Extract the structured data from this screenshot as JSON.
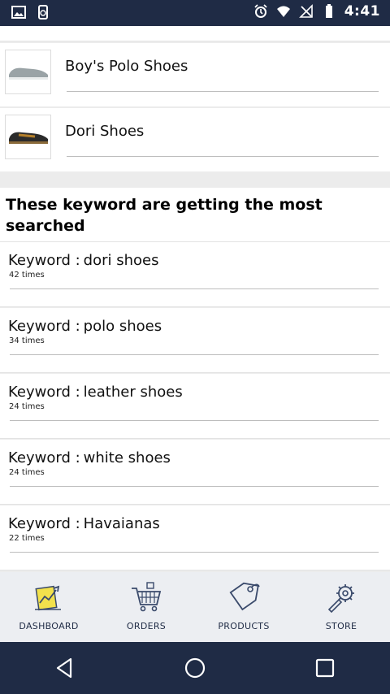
{
  "status_bar": {
    "time": "4:41",
    "icons": [
      "gallery-icon",
      "screenshot-icon",
      "alarm-icon",
      "wifi-icon",
      "no-signal-icon",
      "battery-icon"
    ]
  },
  "products": [
    {
      "name": "Boy's Polo Shoes",
      "image": "grey-shoe-image"
    },
    {
      "name": "Dori Shoes",
      "image": "black-shoe-image"
    }
  ],
  "keywords_section": {
    "title": "These keyword are getting the most searched",
    "items": [
      {
        "label": "Keyword :",
        "value": "dori shoes",
        "count": "42 times"
      },
      {
        "label": "Keyword :",
        "value": "polo shoes",
        "count": "34 times"
      },
      {
        "label": "Keyword :",
        "value": "leather shoes",
        "count": "24 times"
      },
      {
        "label": "Keyword :",
        "value": "white shoes",
        "count": "24 times"
      },
      {
        "label": "Keyword :",
        "value": "Havaianas",
        "count": "22 times"
      }
    ]
  },
  "bottom_nav": [
    {
      "label": "DASHBOARD",
      "icon": "dashboard-icon"
    },
    {
      "label": "ORDERS",
      "icon": "cart-icon"
    },
    {
      "label": "PRODUCTS",
      "icon": "tag-icon"
    },
    {
      "label": "STORE",
      "icon": "tools-icon"
    }
  ],
  "colors": {
    "status_bar_bg": "#1f2b45",
    "nav_bg": "#eceef2",
    "icon_accent": "#f2e14c"
  }
}
